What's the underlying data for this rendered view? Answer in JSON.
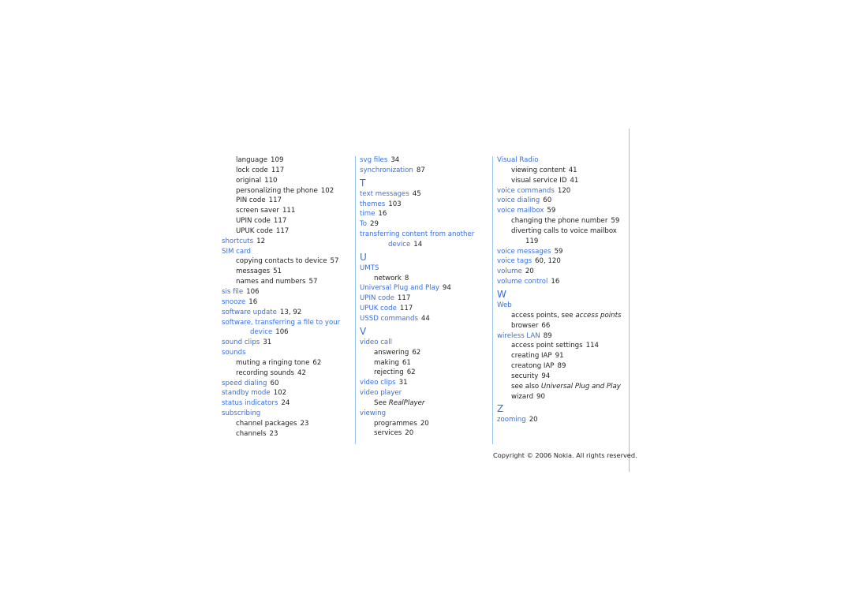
{
  "columns": [
    [
      {
        "k": "sub",
        "text": "language",
        "pages": "109"
      },
      {
        "k": "sub",
        "text": "lock code",
        "pages": "117"
      },
      {
        "k": "sub",
        "text": "original",
        "pages": "110"
      },
      {
        "k": "sub",
        "text": "personalizing the phone",
        "pages": "102"
      },
      {
        "k": "sub",
        "text": "PIN code",
        "pages": "117"
      },
      {
        "k": "sub",
        "text": "screen saver",
        "pages": "111"
      },
      {
        "k": "sub",
        "text": "UPIN code",
        "pages": "117"
      },
      {
        "k": "sub",
        "text": "UPUK code",
        "pages": "117"
      },
      {
        "k": "term",
        "text": "shortcuts",
        "pages": "12"
      },
      {
        "k": "term",
        "text": "SIM card"
      },
      {
        "k": "sub",
        "text": "copying contacts to device",
        "pages": "57"
      },
      {
        "k": "sub",
        "text": "messages",
        "pages": "51"
      },
      {
        "k": "sub",
        "text": "names and numbers",
        "pages": "57"
      },
      {
        "k": "term",
        "text": "sis file",
        "pages": "106"
      },
      {
        "k": "term",
        "text": "snooze",
        "pages": "16"
      },
      {
        "k": "term",
        "text": "software update",
        "pages": "13, 92"
      },
      {
        "k": "term",
        "text": "software, transferring a file to your",
        "text2": "device",
        "pages": "106"
      },
      {
        "k": "term",
        "text": "sound clips",
        "pages": "31"
      },
      {
        "k": "term",
        "text": "sounds"
      },
      {
        "k": "sub",
        "text": "muting a ringing tone",
        "pages": "62"
      },
      {
        "k": "sub",
        "text": "recording sounds",
        "pages": "42"
      },
      {
        "k": "term",
        "text": "speed dialing",
        "pages": "60"
      },
      {
        "k": "term",
        "text": "standby mode",
        "pages": "102"
      },
      {
        "k": "term",
        "text": "status indicators",
        "pages": "24"
      },
      {
        "k": "term",
        "text": "subscribing"
      },
      {
        "k": "sub",
        "text": "channel packages",
        "pages": "23"
      },
      {
        "k": "sub",
        "text": "channels",
        "pages": "23"
      }
    ],
    [
      {
        "k": "term",
        "text": "svg files",
        "pages": "34"
      },
      {
        "k": "term",
        "text": "synchronization",
        "pages": "87"
      },
      {
        "k": "letter",
        "text": "T"
      },
      {
        "k": "term",
        "text": "text messages",
        "pages": "45"
      },
      {
        "k": "term",
        "text": "themes",
        "pages": "103"
      },
      {
        "k": "term",
        "text": "time",
        "pages": "16"
      },
      {
        "k": "term",
        "text": "To",
        "pages": "29"
      },
      {
        "k": "term",
        "text": "transferring content from another",
        "text2": "device",
        "pages": "14"
      },
      {
        "k": "letter",
        "text": "U"
      },
      {
        "k": "term",
        "text": "UMTS"
      },
      {
        "k": "sub",
        "text": "network",
        "pages": "8"
      },
      {
        "k": "term",
        "text": "Universal Plug and Play",
        "pages": "94"
      },
      {
        "k": "term",
        "text": "UPIN code",
        "pages": "117"
      },
      {
        "k": "term",
        "text": "UPUK code",
        "pages": "117"
      },
      {
        "k": "term",
        "text": "USSD commands",
        "pages": "44"
      },
      {
        "k": "letter",
        "text": "V"
      },
      {
        "k": "term",
        "text": "video call"
      },
      {
        "k": "sub",
        "text": "answering",
        "pages": "62"
      },
      {
        "k": "sub",
        "text": "making",
        "pages": "61"
      },
      {
        "k": "sub",
        "text": "rejecting",
        "pages": "62"
      },
      {
        "k": "term",
        "text": "video clips",
        "pages": "31"
      },
      {
        "k": "term",
        "text": "video player"
      },
      {
        "k": "sub",
        "text": "See",
        "italic": "RealPlayer"
      },
      {
        "k": "term",
        "text": "viewing"
      },
      {
        "k": "sub",
        "text": "programmes",
        "pages": "20"
      },
      {
        "k": "sub",
        "text": "services",
        "pages": "20"
      }
    ],
    [
      {
        "k": "term",
        "text": "Visual Radio"
      },
      {
        "k": "sub",
        "text": "viewing content",
        "pages": "41"
      },
      {
        "k": "sub",
        "text": "visual service ID",
        "pages": "41"
      },
      {
        "k": "term",
        "text": "voice commands",
        "pages": "120"
      },
      {
        "k": "term",
        "text": "voice dialing",
        "pages": "60"
      },
      {
        "k": "term",
        "text": "voice mailbox",
        "pages": "59"
      },
      {
        "k": "sub",
        "text": "changing the phone number",
        "pages": "59"
      },
      {
        "k": "sub",
        "text": "diverting calls to voice mailbox",
        "text2": "",
        "pages": "119"
      },
      {
        "k": "term",
        "text": "voice messages",
        "pages": "59"
      },
      {
        "k": "term",
        "text": "voice tags",
        "pages": "60, 120"
      },
      {
        "k": "term",
        "text": "volume",
        "pages": "20"
      },
      {
        "k": "term",
        "text": "volume control",
        "pages": "16"
      },
      {
        "k": "letter",
        "text": "W"
      },
      {
        "k": "term",
        "text": "Web"
      },
      {
        "k": "sub",
        "text": "access points, see",
        "italic": "access points"
      },
      {
        "k": "sub",
        "text": "browser",
        "pages": "66"
      },
      {
        "k": "term",
        "text": "wireless LAN",
        "pages": "89"
      },
      {
        "k": "sub",
        "text": "access point settings",
        "pages": "114"
      },
      {
        "k": "sub",
        "text": "creating IAP",
        "pages": "91"
      },
      {
        "k": "sub",
        "text": "creatong IAP",
        "pages": "89"
      },
      {
        "k": "sub",
        "text": "security",
        "pages": "94"
      },
      {
        "k": "sub",
        "text": "see also",
        "italic": "Universal Plug and Play"
      },
      {
        "k": "sub",
        "text": "wizard",
        "pages": "90"
      },
      {
        "k": "letter",
        "text": "Z"
      },
      {
        "k": "term",
        "text": "zooming",
        "pages": "20"
      }
    ]
  ],
  "footer": {
    "copyright": "Copyright © 2006 Nokia. All rights reserved."
  },
  "colors": {
    "link": "#3a6fe0",
    "text": "#222222",
    "rule": "#9cc3ea"
  }
}
